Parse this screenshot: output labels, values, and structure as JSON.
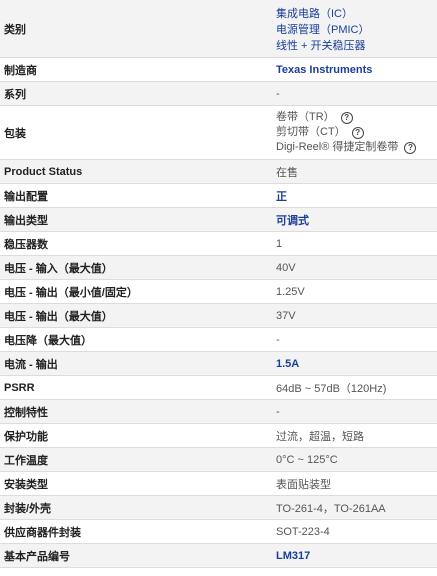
{
  "rows": [
    {
      "label": "类别",
      "values": [
        "集成电路（IC）",
        "电源管理（PMIC）",
        "线性 + 开关稳压器"
      ]
    },
    {
      "label": "制造商",
      "value": "Texas Instruments"
    },
    {
      "label": "系列",
      "value": "-"
    },
    {
      "label": "包装",
      "values": [
        "卷带（TR）",
        "剪切带（CT）",
        "Digi-Reel® 得捷定制卷带"
      ]
    },
    {
      "label": "Product Status",
      "value": "在售"
    },
    {
      "label": "输出配置",
      "value": "正"
    },
    {
      "label": "输出类型",
      "value": "可调式"
    },
    {
      "label": "稳压器数",
      "value": "1"
    },
    {
      "label": "电压 - 输入（最大值）",
      "value": "40V"
    },
    {
      "label": "电压 - 输出（最小值/固定）",
      "value": "1.25V"
    },
    {
      "label": "电压 - 输出（最大值）",
      "value": "37V"
    },
    {
      "label": "电压降（最大值）",
      "value": "-"
    },
    {
      "label": "电流 - 输出",
      "value": "1.5A"
    },
    {
      "label": "PSRR",
      "value": "64dB ~ 57dB（120Hz)"
    },
    {
      "label": "控制特性",
      "value": "-"
    },
    {
      "label": "保护功能",
      "value": "过流，超温，短路"
    },
    {
      "label": "工作温度",
      "value": "0°C ~ 125°C"
    },
    {
      "label": "安装类型",
      "value": "表面贴装型"
    },
    {
      "label": "封装/外壳",
      "value": "TO-261-4，TO-261AA"
    },
    {
      "label": "供应商器件封装",
      "value": "SOT-223-4"
    },
    {
      "label": "基本产品编号",
      "value": "LM317"
    }
  ]
}
